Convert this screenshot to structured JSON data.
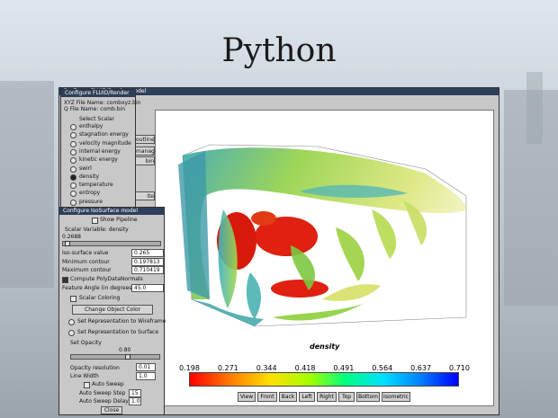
{
  "slide_title": "Python",
  "main_window": {
    "title": "Configure FLUID/Render model"
  },
  "scalar_panel": {
    "file_label": "XYZ File Name: combxyz.bin",
    "q_file_label": "Q File Name: comb.bin",
    "group_label": "Select Scalar",
    "scalars": [
      {
        "label": "enthalpy",
        "selected": false
      },
      {
        "label": "stagnation energy",
        "selected": false
      },
      {
        "label": "velocity magnitude",
        "selected": false
      },
      {
        "label": "internal energy",
        "selected": false
      },
      {
        "label": "kinetic energy",
        "selected": false
      },
      {
        "label": "swirl",
        "selected": false
      },
      {
        "label": "density",
        "selected": true
      },
      {
        "label": "temperature",
        "selected": false
      },
      {
        "label": "entropy",
        "selected": false
      },
      {
        "label": "pressure",
        "selected": false
      }
    ]
  },
  "side_buttons": [
    "outline",
    "manager",
    "bin",
    "ite"
  ],
  "iso_panel": {
    "title": "Configure IsoSurface model",
    "show_pipeline": "Show Pipeline",
    "scalar_variable_label": "Scalar Variable: density",
    "scalar_value": "0.2688",
    "iso_value_label": "Iso-surface value",
    "iso_value": "0.265",
    "min_contour_label": "Minimum contour",
    "min_contour": "0.197813",
    "max_contour_label": "Maximum contour",
    "max_contour": "0.710419",
    "compute_normals": "Compute PolyDataNormals",
    "feature_angle_label": "Feature Angle (in degrees)",
    "feature_angle": "45.0",
    "scalar_coloring": "Scalar Coloring",
    "change_color": "Change Object Color",
    "wireframe": "Set Representation to Wireframe",
    "surface": "Set Representation to Surface",
    "opacity_label": "Set Opacity",
    "opacity_value": "0.80",
    "opacity_resolution_label": "Opacity resolution",
    "opacity_resolution": "0.01",
    "line_width_label": "Line Width",
    "line_width": "1.0",
    "auto_sweep": "Auto Sweep",
    "sweep_step_label": "Auto Sweep Step",
    "sweep_step": "15",
    "sweep_delay_label": "Auto Sweep Delay",
    "sweep_delay": "1.0",
    "close": "Close"
  },
  "render": {
    "colorbar_title": "density",
    "colorbar_ticks": [
      "0.198",
      "0.271",
      "0.344",
      "0.418",
      "0.491",
      "0.564",
      "0.637",
      "0.710"
    ],
    "view_buttons": [
      "View",
      "Front",
      "Back",
      "Left",
      "Right",
      "Top",
      "Bottom",
      "Isometric"
    ]
  }
}
